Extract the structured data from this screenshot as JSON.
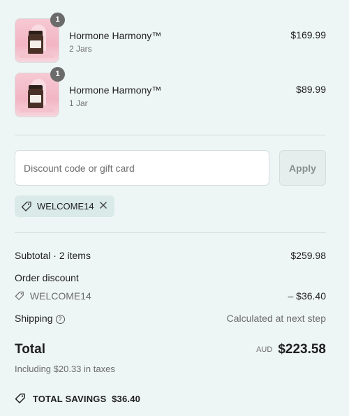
{
  "line_items": [
    {
      "quantity_badge": "1",
      "name": "Hormone Harmony™",
      "variant": "2 Jars",
      "price": "$169.99"
    },
    {
      "quantity_badge": "1",
      "name": "Hormone Harmony™",
      "variant": "1 Jar",
      "price": "$89.99"
    }
  ],
  "discount": {
    "placeholder": "Discount code or gift card",
    "apply_label": "Apply",
    "applied_code": "WELCOME14"
  },
  "summary": {
    "subtotal_label": "Subtotal · 2 items",
    "subtotal_value": "$259.98",
    "order_discount_label": "Order discount",
    "discount_code": "WELCOME14",
    "discount_value": "– $36.40",
    "shipping_label": "Shipping",
    "shipping_value": "Calculated at next step",
    "total_label": "Total",
    "currency": "AUD",
    "total_value": "$223.58",
    "taxes_note": "Including $20.33 in taxes",
    "savings_label": "TOTAL SAVINGS",
    "savings_value": "$36.40"
  },
  "icons": {
    "tag": "tag-icon",
    "close": "close-icon",
    "help": "question-circle-icon"
  },
  "colors": {
    "background": "#eef6f5",
    "chip": "#d9eae8",
    "badge": "#6b6b6b"
  }
}
